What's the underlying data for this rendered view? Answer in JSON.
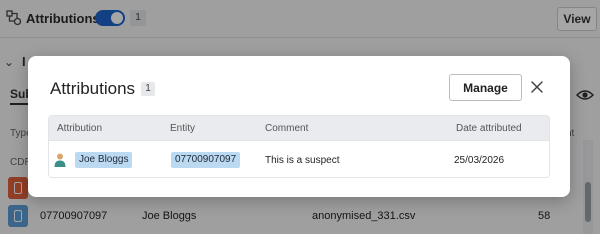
{
  "app": {
    "title": "Attributions",
    "toggle_on": true,
    "count": "1",
    "view_label": "View",
    "section_title": "I",
    "tab_label": "Sub",
    "table_head_left": "Type",
    "table_head_right": "nt",
    "cdr_label": "CDR",
    "rows": [
      {
        "color": "#e0603b",
        "c1": "",
        "c2": "",
        "c3": "",
        "c4": ""
      },
      {
        "color": "#5b9bd5",
        "c1": "07700907097",
        "c2": "Joe Bloggs",
        "c3": "anonymised_331.csv",
        "c4": "58"
      }
    ]
  },
  "modal": {
    "title": "Attributions",
    "count": "1",
    "manage_label": "Manage",
    "columns": [
      "Attribution",
      "Entity",
      "Comment",
      "Date attributed"
    ],
    "rows": [
      {
        "attribution": "Joe Bloggs",
        "entity": "07700907097",
        "comment": "This is a suspect",
        "date": "25/03/2026"
      }
    ]
  },
  "colors": {
    "accent": "#1e63c8",
    "chip": "#bcd9f2",
    "person_icon": "#3a8f8a"
  },
  "icons": {
    "attributions": "attribution-icon",
    "close": "close-icon",
    "eye": "eye-icon",
    "person": "person-icon"
  }
}
